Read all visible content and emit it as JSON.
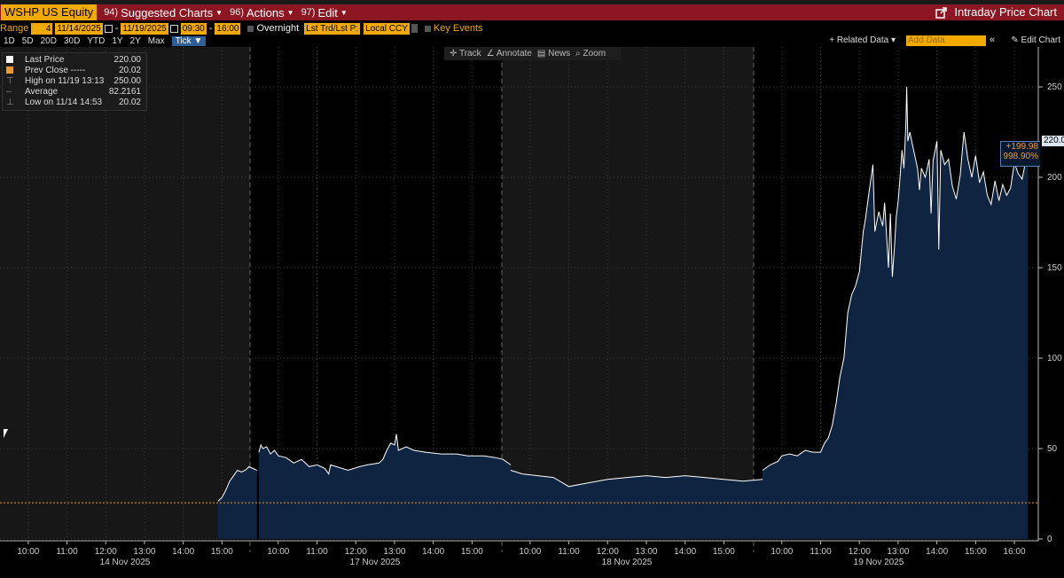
{
  "menu": {
    "ticker": "WSHP US Equity",
    "items": [
      {
        "num": "94)",
        "label": "Suggested Charts",
        "caret": true
      },
      {
        "num": "96)",
        "label": "Actions",
        "caret": true
      },
      {
        "num": "97)",
        "label": "Edit",
        "caret": true
      }
    ],
    "chart_title": "Intraday Price Chart"
  },
  "controls": {
    "range_label": "Range",
    "range_value": "4",
    "start_date": "11/14/2025",
    "end_date": "11/19/2025",
    "start_time": "09:30",
    "end_time": "16:00",
    "overnight_label": "Overnight",
    "price_source": "Lst Trd/Lst P:",
    "currency": "Local CCY",
    "key_events_label": "Key Events"
  },
  "periods": [
    "1D",
    "5D",
    "20D",
    "30D",
    "YTD",
    "1Y",
    "2Y",
    "Max"
  ],
  "period_selected": "Tick ▼",
  "related_data_label": "+ Related Data ▾",
  "add_data_placeholder": "Add Data",
  "chevron_label": "«",
  "edit_chart_label": "Edit Chart",
  "toolbar": {
    "track": "Track",
    "annotate": "Annotate",
    "news": "News",
    "zoom": "Zoom"
  },
  "legend": {
    "last_price_label": "Last Price",
    "last_price_value": "220.00",
    "prev_close_label": "Prev Close -----",
    "prev_close_value": "20.02",
    "high_label": "High on 11/19 13:13",
    "high_value": "250.00",
    "average_label": "Average",
    "average_value": "82.2161",
    "low_label": "Low on 11/14 14:53",
    "low_value": "20.02"
  },
  "last_price_tag": "220.0",
  "change_abs": "+199.98",
  "change_pct": "998.90%",
  "colors": {
    "menu_bar": "#8c1722",
    "accent": "#f2a900",
    "area_fill": "#0e2440",
    "line": "#ffffff",
    "prev_close_line": "#f29b2a"
  },
  "chart_data": {
    "type": "area",
    "x_labels": [
      [
        "10:00",
        "11:00",
        "12:00",
        "13:00",
        "14:00",
        "15:00"
      ],
      [
        "10:00",
        "11:00",
        "12:00",
        "13:00",
        "14:00",
        "15:00"
      ],
      [
        "10:00",
        "11:00",
        "12:00",
        "13:00",
        "14:00",
        "15:00"
      ],
      [
        "10:00",
        "11:00",
        "12:00",
        "13:00",
        "14:00",
        "15:00",
        "16:00"
      ]
    ],
    "day_labels": [
      "14 Nov 2025",
      "17 Nov 2025",
      "18 Nov 2025",
      "19 Nov 2025"
    ],
    "y_ticks": [
      0,
      50,
      100,
      150,
      200,
      250
    ],
    "ylim": [
      0,
      250
    ],
    "prev_close": 20.02,
    "series": [
      {
        "day": 0,
        "points": [
          [
            14.9,
            21
          ],
          [
            15.0,
            23
          ],
          [
            15.1,
            27
          ],
          [
            15.2,
            32
          ],
          [
            15.3,
            35
          ],
          [
            15.4,
            38
          ],
          [
            15.5,
            37
          ],
          [
            15.6,
            38
          ],
          [
            15.7,
            40
          ],
          [
            15.9,
            38
          ]
        ]
      },
      {
        "day": 1,
        "points": [
          [
            9.5,
            48
          ],
          [
            9.55,
            52
          ],
          [
            9.6,
            50
          ],
          [
            9.7,
            51
          ],
          [
            9.8,
            47
          ],
          [
            9.9,
            49
          ],
          [
            10.0,
            46
          ],
          [
            10.2,
            45
          ],
          [
            10.4,
            42
          ],
          [
            10.6,
            44
          ],
          [
            10.8,
            40
          ],
          [
            11.0,
            41
          ],
          [
            11.2,
            39
          ],
          [
            11.3,
            36
          ],
          [
            11.35,
            41
          ],
          [
            11.5,
            40
          ],
          [
            11.8,
            38
          ],
          [
            12.1,
            40
          ],
          [
            12.3,
            41
          ],
          [
            12.6,
            42
          ],
          [
            12.7,
            44
          ],
          [
            12.8,
            49
          ],
          [
            12.9,
            53
          ],
          [
            13.0,
            52
          ],
          [
            13.05,
            58
          ],
          [
            13.1,
            49
          ],
          [
            13.3,
            51
          ],
          [
            13.5,
            49
          ],
          [
            13.8,
            48
          ],
          [
            14.2,
            47
          ],
          [
            14.6,
            47
          ],
          [
            14.9,
            46
          ],
          [
            15.3,
            46
          ],
          [
            15.6,
            45
          ],
          [
            15.8,
            44
          ],
          [
            16.0,
            41
          ]
        ]
      },
      {
        "day": 2,
        "points": [
          [
            9.5,
            38
          ],
          [
            9.8,
            36
          ],
          [
            10.2,
            35
          ],
          [
            10.6,
            34
          ],
          [
            11.0,
            29
          ],
          [
            11.5,
            31
          ],
          [
            12.0,
            33
          ],
          [
            12.5,
            34
          ],
          [
            13.0,
            35
          ],
          [
            13.5,
            34
          ],
          [
            14.0,
            35
          ],
          [
            14.5,
            34
          ],
          [
            15.0,
            33
          ],
          [
            15.5,
            32
          ],
          [
            16.0,
            33
          ]
        ]
      },
      {
        "day": 3,
        "points": [
          [
            9.5,
            38
          ],
          [
            9.7,
            41
          ],
          [
            9.9,
            43
          ],
          [
            10.0,
            46
          ],
          [
            10.2,
            47
          ],
          [
            10.4,
            46
          ],
          [
            10.6,
            49
          ],
          [
            10.8,
            48
          ],
          [
            11.0,
            48
          ],
          [
            11.1,
            53
          ],
          [
            11.2,
            56
          ],
          [
            11.3,
            63
          ],
          [
            11.4,
            75
          ],
          [
            11.5,
            90
          ],
          [
            11.6,
            100
          ],
          [
            11.7,
            125
          ],
          [
            11.8,
            135
          ],
          [
            11.9,
            140
          ],
          [
            12.0,
            148
          ],
          [
            12.1,
            170
          ],
          [
            12.15,
            176
          ],
          [
            12.25,
            192
          ],
          [
            12.35,
            207
          ],
          [
            12.4,
            170
          ],
          [
            12.5,
            181
          ],
          [
            12.6,
            173
          ],
          [
            12.65,
            186
          ],
          [
            12.75,
            150
          ],
          [
            12.8,
            180
          ],
          [
            12.85,
            145
          ],
          [
            12.9,
            160
          ],
          [
            12.95,
            178
          ],
          [
            13.0,
            187
          ],
          [
            13.05,
            200
          ],
          [
            13.1,
            215
          ],
          [
            13.15,
            205
          ],
          [
            13.2,
            230
          ],
          [
            13.22,
            250
          ],
          [
            13.25,
            220
          ],
          [
            13.3,
            225
          ],
          [
            13.4,
            215
          ],
          [
            13.5,
            205
          ],
          [
            13.55,
            193
          ],
          [
            13.6,
            205
          ],
          [
            13.7,
            200
          ],
          [
            13.8,
            210
          ],
          [
            13.85,
            180
          ],
          [
            13.9,
            209
          ],
          [
            14.0,
            220
          ],
          [
            14.05,
            160
          ],
          [
            14.1,
            215
          ],
          [
            14.2,
            207
          ],
          [
            14.3,
            210
          ],
          [
            14.4,
            195
          ],
          [
            14.5,
            188
          ],
          [
            14.6,
            201
          ],
          [
            14.7,
            225
          ],
          [
            14.8,
            210
          ],
          [
            14.9,
            200
          ],
          [
            15.0,
            212
          ],
          [
            15.1,
            197
          ],
          [
            15.2,
            203
          ],
          [
            15.3,
            190
          ],
          [
            15.4,
            185
          ],
          [
            15.5,
            198
          ],
          [
            15.6,
            187
          ],
          [
            15.7,
            196
          ],
          [
            15.8,
            190
          ],
          [
            15.9,
            194
          ],
          [
            16.0,
            208
          ],
          [
            16.1,
            202
          ],
          [
            16.2,
            199
          ],
          [
            16.3,
            210
          ],
          [
            16.35,
            220
          ]
        ]
      }
    ]
  }
}
